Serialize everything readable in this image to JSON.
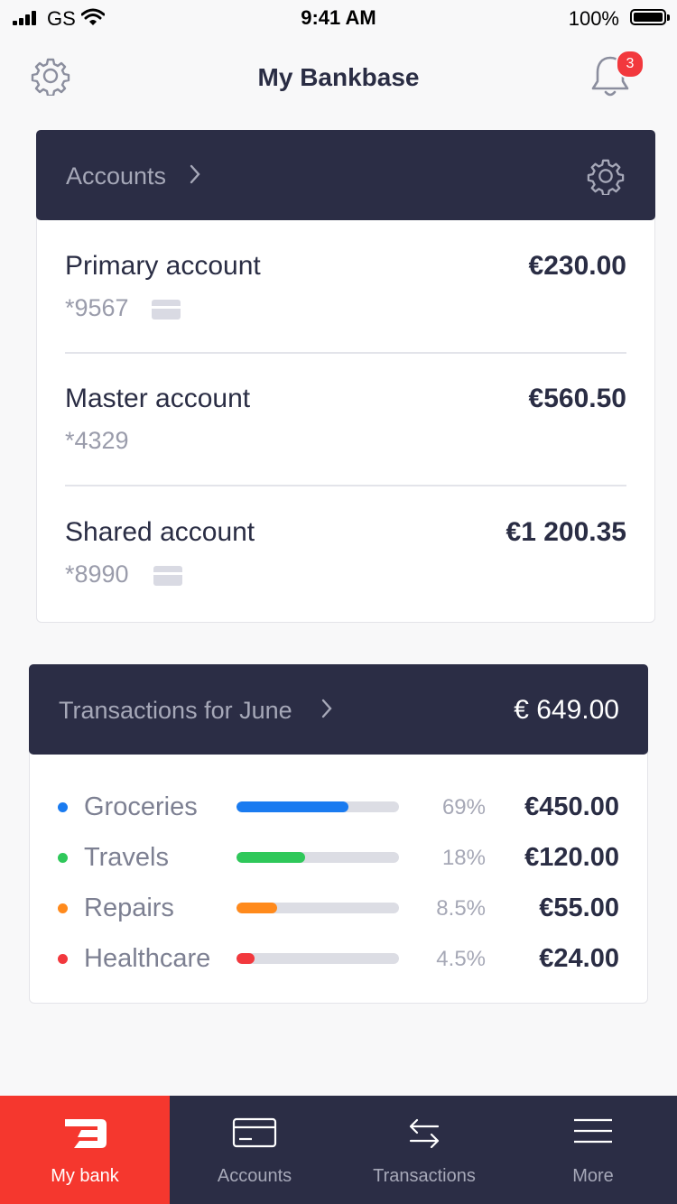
{
  "status_bar": {
    "carrier": "GS",
    "time": "9:41 AM",
    "battery": "100%"
  },
  "header": {
    "title": "My Bankbase",
    "notification_count": "3"
  },
  "accounts": {
    "title": "Accounts",
    "items": [
      {
        "name": "Primary account",
        "number": "*9567",
        "amount": "€230.00",
        "has_card": true
      },
      {
        "name": "Master account",
        "number": "*4329",
        "amount": "€560.50",
        "has_card": false
      },
      {
        "name": "Shared account",
        "number": "*8990",
        "amount": "€1 200.35",
        "has_card": true
      }
    ]
  },
  "transactions": {
    "title": "Transactions for June",
    "total": "€ 649.00",
    "categories": [
      {
        "name": "Groceries",
        "percent": "69%",
        "share": 0.69,
        "amount": "€450.00",
        "color": "#1a7bf0"
      },
      {
        "name": "Travels",
        "percent": "18%",
        "share": 0.42,
        "amount": "€120.00",
        "color": "#2fc85a"
      },
      {
        "name": "Repairs",
        "percent": "8.5%",
        "share": 0.25,
        "amount": "€55.00",
        "color": "#ff8a1c"
      },
      {
        "name": "Healthcare",
        "percent": "4.5%",
        "share": 0.11,
        "amount": "€24.00",
        "color": "#f2383d"
      }
    ]
  },
  "tabs": [
    {
      "label": "My bank",
      "icon": "bank-logo-icon",
      "active": true
    },
    {
      "label": "Accounts",
      "icon": "card-icon",
      "active": false
    },
    {
      "label": "Transactions",
      "icon": "transfer-arrows-icon",
      "active": false
    },
    {
      "label": "More",
      "icon": "menu-icon",
      "active": false
    }
  ],
  "colors": {
    "dark": "#2b2d45",
    "accent": "#f5372e",
    "background": "#f8f8f9"
  }
}
